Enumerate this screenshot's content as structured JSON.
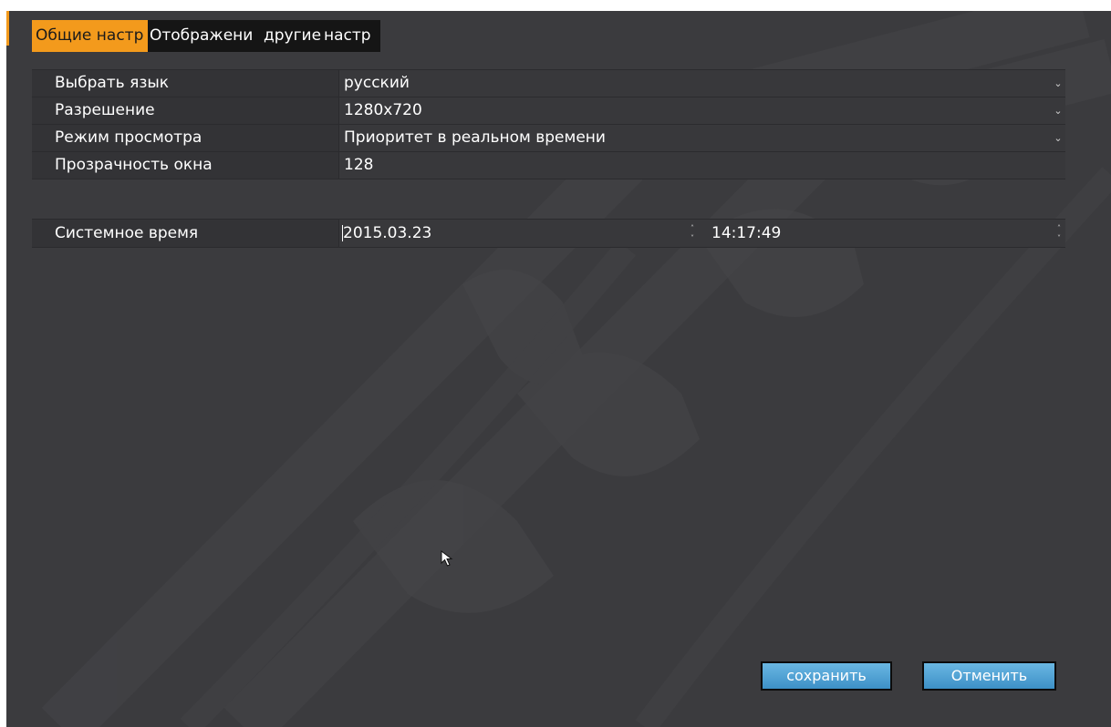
{
  "tabs": [
    {
      "label": "Общие настр",
      "active": true
    },
    {
      "label": "Отображени",
      "active": false
    },
    {
      "label": "другие",
      "active": false
    },
    {
      "label": "настр",
      "active": false
    }
  ],
  "settings": {
    "rows": [
      {
        "label": "Выбрать язык",
        "value": "русский",
        "has_dropdown": true
      },
      {
        "label": "Разрешение",
        "value": "1280x720",
        "has_dropdown": true
      },
      {
        "label": "Режим просмотра",
        "value": "Приоритет в реальном времени",
        "has_dropdown": true
      },
      {
        "label": "Прозрачность окна",
        "value": "128",
        "has_dropdown": false
      }
    ]
  },
  "system_time": {
    "label": "Системное время",
    "date": "2015.03.23",
    "time": "14:17:49"
  },
  "buttons": {
    "save_label": "сохранить",
    "cancel_label": "Отменить"
  },
  "colors": {
    "panel_bg": "#3b3b3e",
    "active_tab": "#f39a1c",
    "button_top": "#6ab7e2",
    "button_bottom": "#3d90c7"
  },
  "icons": {
    "dropdown": "chevron-down-icon",
    "spinner": "spinner-icon",
    "cursor": "mouse-pointer-icon"
  }
}
